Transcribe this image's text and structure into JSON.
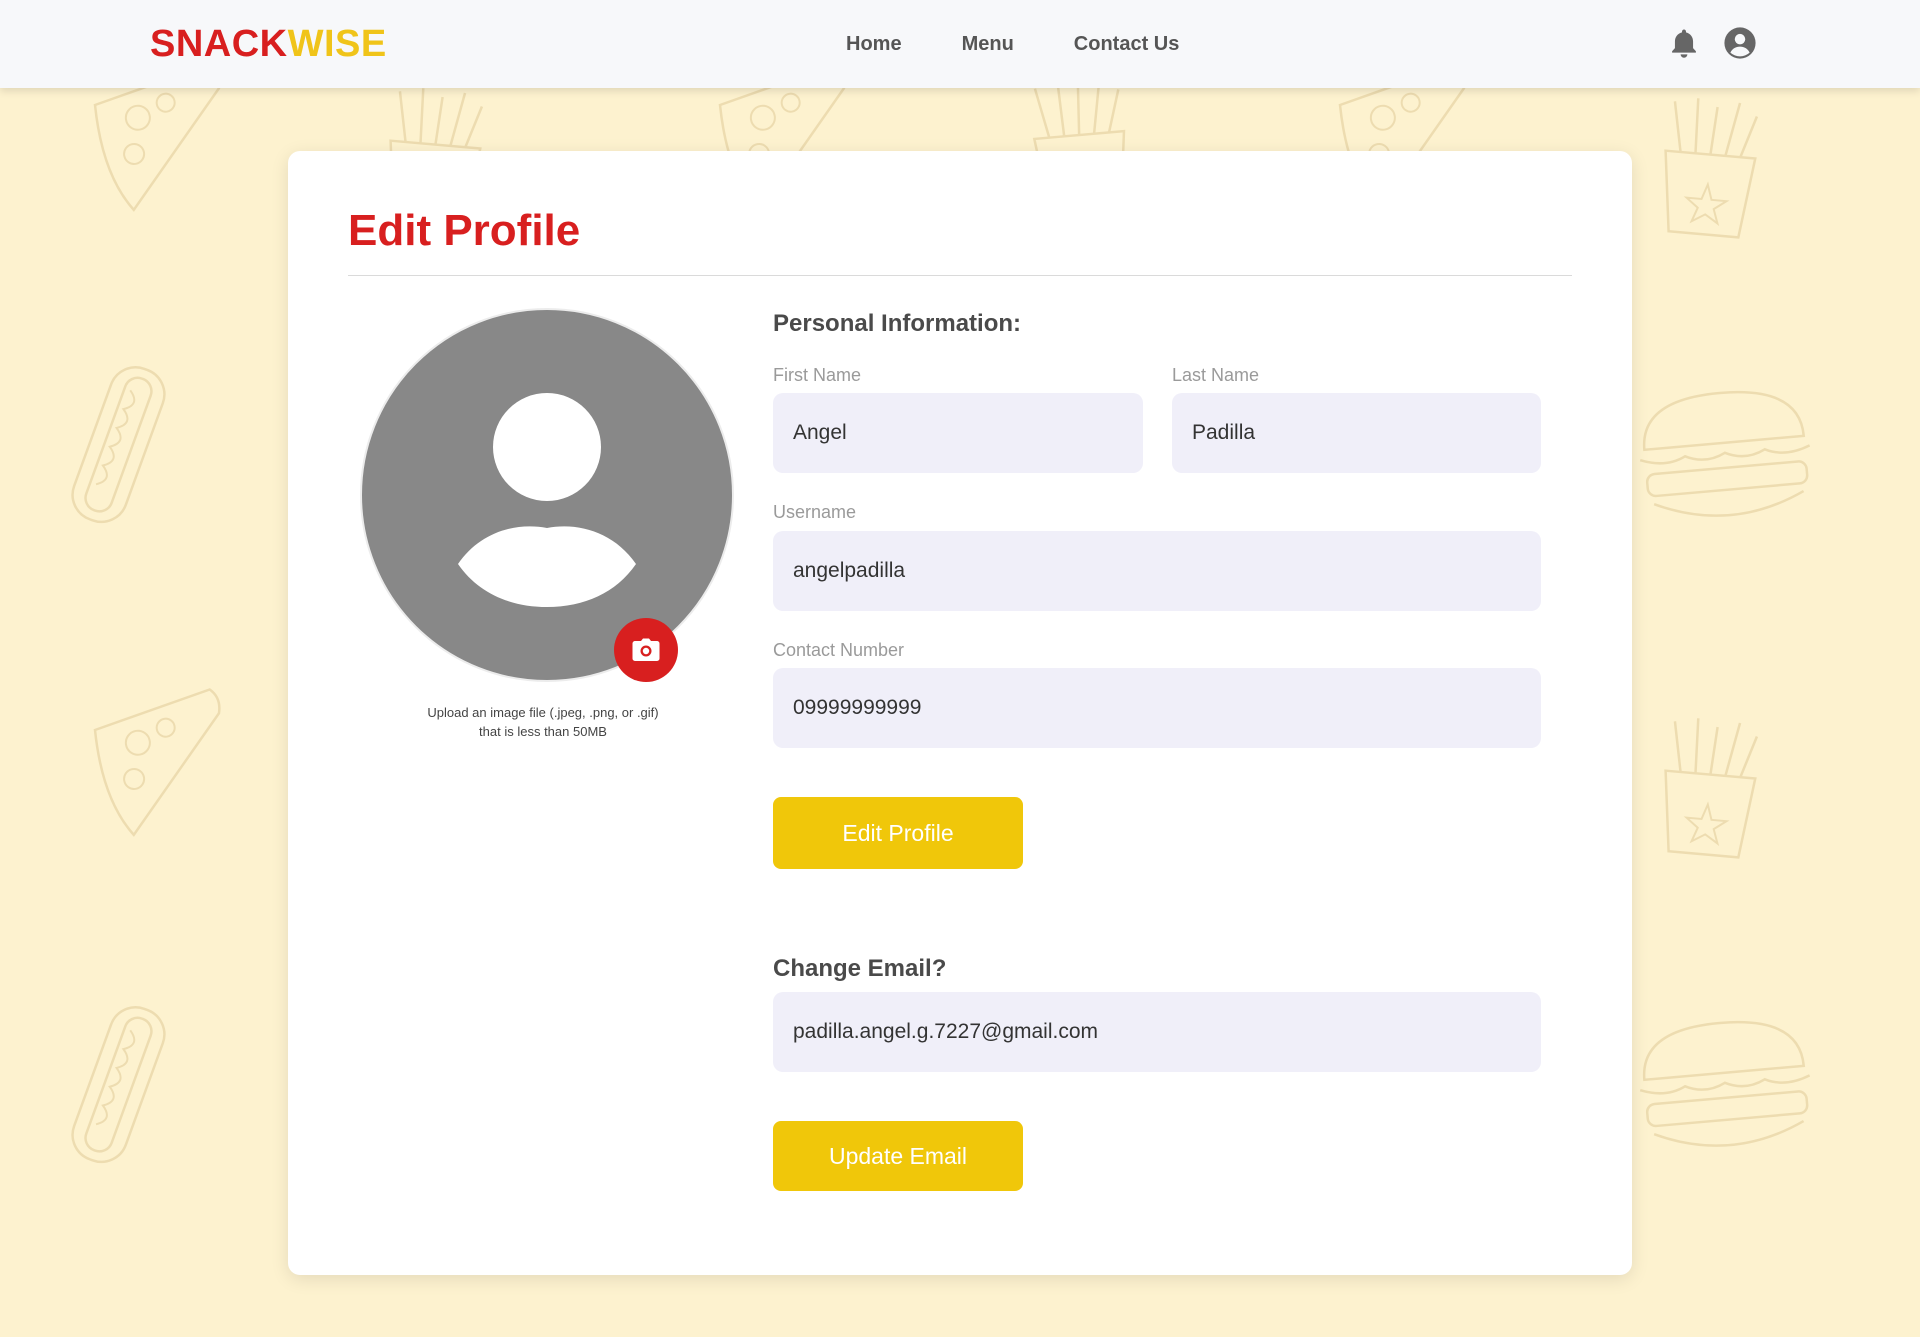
{
  "brand": {
    "part1": "SNACK",
    "part2": "WISE"
  },
  "nav": {
    "links": [
      {
        "label": "Home"
      },
      {
        "label": "Menu"
      },
      {
        "label": "Contact Us"
      }
    ],
    "icons": [
      "bell-icon",
      "user-circle-icon"
    ]
  },
  "colors": {
    "brand_red": "#d81f1f",
    "brand_yellow": "#f0c419",
    "button_yellow": "#f0c70a",
    "input_bg": "#f0eff9",
    "page_bg": "#fdf2cf",
    "avatar_gray": "#888888"
  },
  "page": {
    "title": "Edit Profile"
  },
  "avatar": {
    "icon": "camera-icon",
    "hint_line1": "Upload an image file (.jpeg, .png, or .gif)",
    "hint_line2": "that is less than 50MB"
  },
  "personal": {
    "heading": "Personal Information:",
    "first_name": {
      "label": "First Name",
      "value": "Angel"
    },
    "last_name": {
      "label": "Last Name",
      "value": "Padilla"
    },
    "username": {
      "label": "Username",
      "value": "angelpadilla"
    },
    "contact": {
      "label": "Contact Number",
      "value": "09999999999"
    },
    "button": "Edit Profile"
  },
  "email": {
    "heading": "Change Email?",
    "value": "padilla.angel.g.7227@gmail.com",
    "button": "Update Email"
  }
}
